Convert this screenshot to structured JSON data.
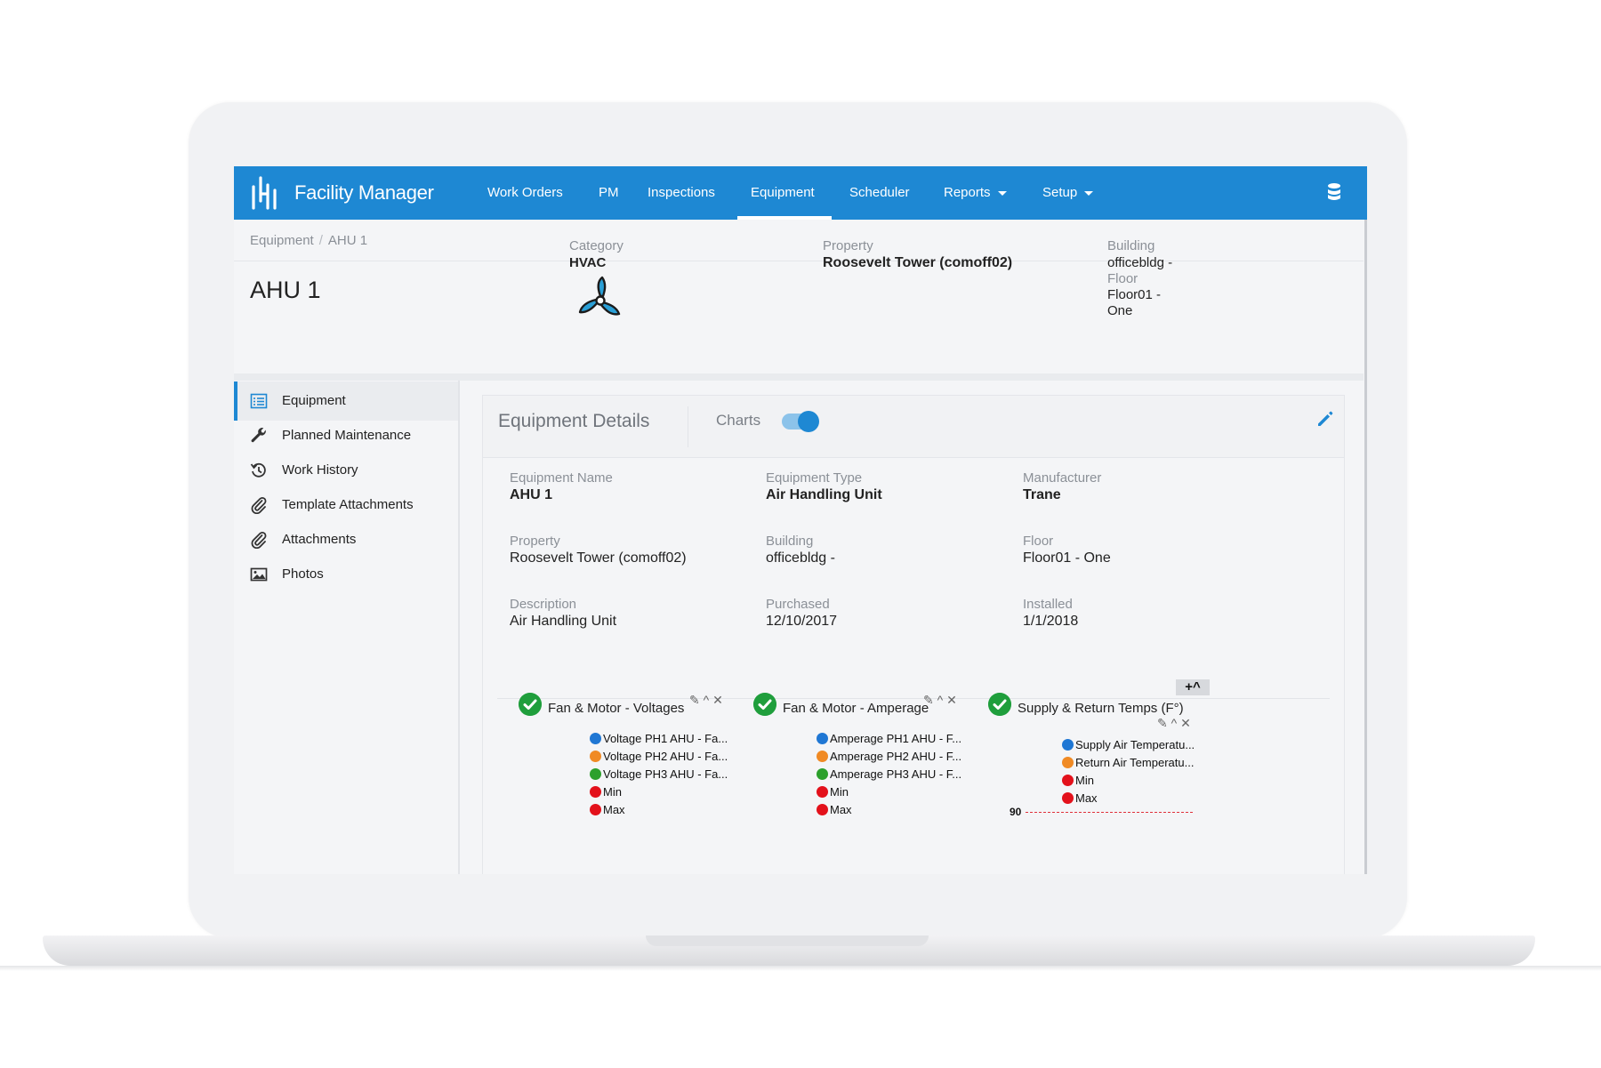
{
  "app": {
    "brand": "Facility Manager"
  },
  "nav": {
    "items": [
      {
        "label": "Work Orders"
      },
      {
        "label": "PM"
      },
      {
        "label": "Inspections"
      },
      {
        "label": "Equipment",
        "active": true
      },
      {
        "label": "Scheduler"
      },
      {
        "label": "Reports",
        "dropdown": true
      },
      {
        "label": "Setup",
        "dropdown": true
      }
    ],
    "right_icon": "database-icon"
  },
  "breadcrumb": {
    "root": "Equipment",
    "separator": "/",
    "current": "AHU 1"
  },
  "header": {
    "title": "AHU 1",
    "icon": "fan-icon",
    "category_label": "Category",
    "category_value": "HVAC",
    "property_label": "Property",
    "property_value": "Roosevelt Tower (comoff02)",
    "building_label": "Building",
    "building_value": "officebldg -",
    "floor_label": "Floor",
    "floor_value_1": "Floor01 -",
    "floor_value_2": "One"
  },
  "sidebar": {
    "items": [
      {
        "label": "Equipment",
        "icon": "list-icon",
        "active": true
      },
      {
        "label": "Planned Maintenance",
        "icon": "wrench-icon"
      },
      {
        "label": "Work History",
        "icon": "history-icon"
      },
      {
        "label": "Template Attachments",
        "icon": "paperclip-icon"
      },
      {
        "label": "Attachments",
        "icon": "paperclip-icon"
      },
      {
        "label": "Photos",
        "icon": "image-icon"
      }
    ]
  },
  "panel": {
    "title": "Equipment Details",
    "charts_label": "Charts",
    "charts_toggle_on": true,
    "fields": [
      {
        "label": "Equipment Name",
        "value": "AHU 1",
        "bold": true
      },
      {
        "label": "Equipment Type",
        "value": "Air Handling Unit",
        "bold": true
      },
      {
        "label": "Manufacturer",
        "value": "Trane",
        "bold": true
      },
      {
        "label": "Property",
        "value": "Roosevelt Tower (comoff02)"
      },
      {
        "label": "Building",
        "value": "officebldg -"
      },
      {
        "label": "Floor",
        "value": "Floor01 - One"
      },
      {
        "label": "Description",
        "value": "Air Handling Unit"
      },
      {
        "label": "Purchased",
        "value": "12/10/2017"
      },
      {
        "label": "Installed",
        "value": "1/1/2018"
      }
    ]
  },
  "charts": {
    "add_label": "+^",
    "widgets": [
      {
        "title": "Fan & Motor - Voltages",
        "status_icon": "check-circle-icon",
        "legend": [
          {
            "label": "Voltage PH1 AHU - Fa...",
            "color": "#1f77d4"
          },
          {
            "label": "Voltage PH2 AHU - Fa...",
            "color": "#f08a24"
          },
          {
            "label": "Voltage PH3 AHU - Fa...",
            "color": "#2ca02c"
          },
          {
            "label": "Min",
            "color": "#e3111b"
          },
          {
            "label": "Max",
            "color": "#e3111b"
          }
        ]
      },
      {
        "title": "Fan & Motor - Amperage",
        "status_icon": "check-circle-icon",
        "legend": [
          {
            "label": "Amperage PH1 AHU - F...",
            "color": "#1f77d4"
          },
          {
            "label": "Amperage PH2 AHU - F...",
            "color": "#f08a24"
          },
          {
            "label": "Amperage PH3 AHU - F...",
            "color": "#2ca02c"
          },
          {
            "label": "Min",
            "color": "#e3111b"
          },
          {
            "label": "Max",
            "color": "#e3111b"
          }
        ]
      },
      {
        "title": "Supply & Return Temps (F°)",
        "status_icon": "check-circle-icon",
        "legend": [
          {
            "label": "Supply Air Temperatu...",
            "color": "#1f77d4"
          },
          {
            "label": "Return Air Temperatu...",
            "color": "#f08a24"
          },
          {
            "label": "Min",
            "color": "#e3111b"
          },
          {
            "label": "Max",
            "color": "#e3111b"
          }
        ],
        "axis_tick": "90"
      }
    ]
  },
  "colors": {
    "accent": "#1e88d3",
    "success": "#1f9e3c",
    "limit": "#e3111b"
  }
}
